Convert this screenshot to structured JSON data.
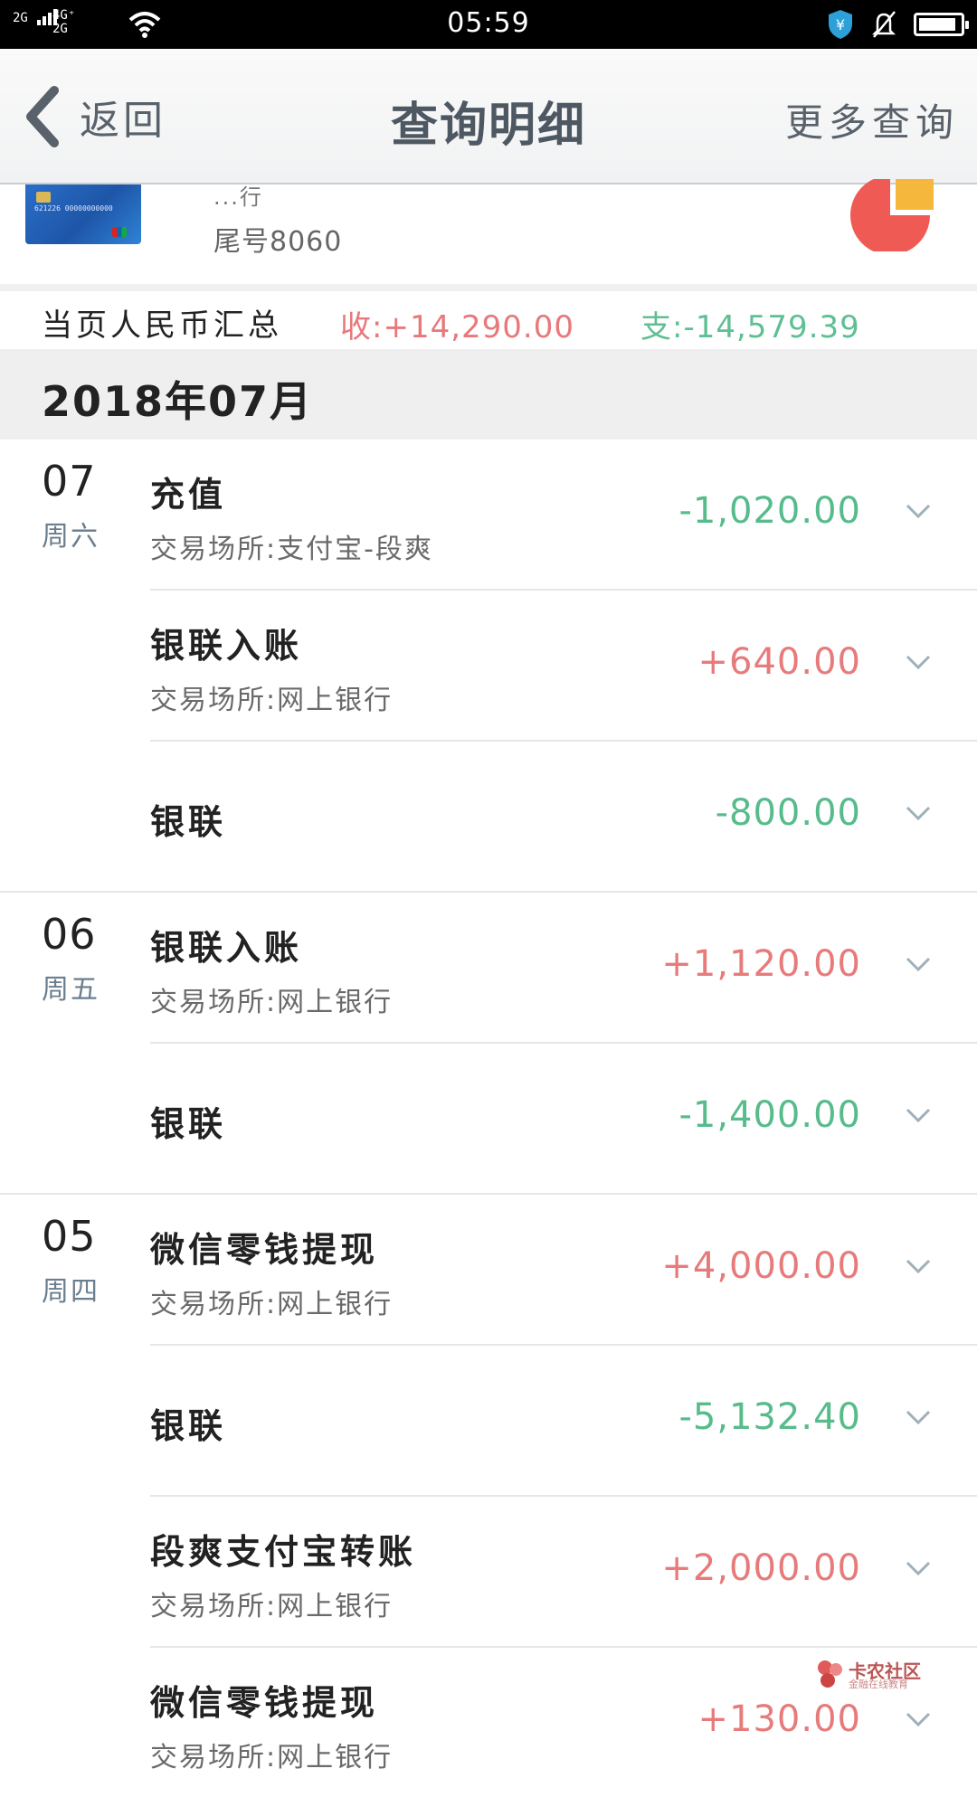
{
  "status_bar": {
    "sim1": "2G",
    "net_top": "4G⁺",
    "net_bottom": "2G",
    "time": "05:59",
    "battery_level": 0.92
  },
  "nav": {
    "back_label": "返回",
    "title": "查询明细",
    "more_label": "更多查询"
  },
  "card": {
    "name_partial": "...行",
    "tail_label": "尾号8060",
    "card_number_small": "621226 00000000000",
    "pie_colors": [
      "#f05a55",
      "#f5b83d"
    ]
  },
  "summary": {
    "label": "当页人民币汇总",
    "income": "收:+14,290.00",
    "expense": "支:-14,579.39"
  },
  "month": "2018年07月",
  "groups": [
    {
      "day": "07",
      "weekday": "周六",
      "items": [
        {
          "title": "充值",
          "sub": "交易场所:支付宝-段爽",
          "amount": "-1,020.00",
          "kind": "neg"
        },
        {
          "title": "银联入账",
          "sub": "交易场所:网上银行",
          "amount": "+640.00",
          "kind": "pos"
        },
        {
          "title": "银联",
          "sub": "",
          "amount": "-800.00",
          "kind": "neg"
        }
      ]
    },
    {
      "day": "06",
      "weekday": "周五",
      "items": [
        {
          "title": "银联入账",
          "sub": "交易场所:网上银行",
          "amount": "+1,120.00",
          "kind": "pos"
        },
        {
          "title": "银联",
          "sub": "",
          "amount": "-1,400.00",
          "kind": "neg"
        }
      ]
    },
    {
      "day": "05",
      "weekday": "周四",
      "items": [
        {
          "title": "微信零钱提现",
          "sub": "交易场所:网上银行",
          "amount": "+4,000.00",
          "kind": "pos"
        },
        {
          "title": "银联",
          "sub": "",
          "amount": "-5,132.40",
          "kind": "neg"
        },
        {
          "title": "段爽支付宝转账",
          "sub": "交易场所:网上银行",
          "amount": "+2,000.00",
          "kind": "pos"
        },
        {
          "title": "微信零钱提现",
          "sub": "交易场所:网上银行",
          "amount": "+130.00",
          "kind": "pos"
        }
      ]
    }
  ],
  "watermark": {
    "title": "卡农社区",
    "sub": "金融在线教育"
  },
  "colors": {
    "income": "#e77b7b",
    "expense": "#57bb8c",
    "nav_text": "#4e5862",
    "weekday": "#6b7e8e"
  }
}
